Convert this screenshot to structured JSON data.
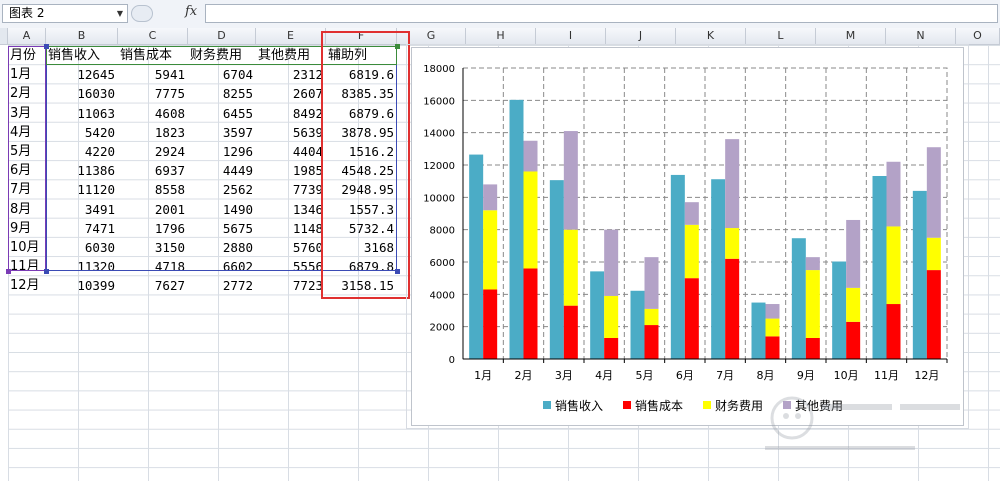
{
  "name_box": {
    "value": "图表 2",
    "dropdown_icon": "triangle-down-icon"
  },
  "formula_bar": {
    "fx_label": "fx",
    "value": ""
  },
  "column_headers": [
    "A",
    "B",
    "C",
    "D",
    "E",
    "F",
    "G",
    "H",
    "I",
    "J",
    "K",
    "L",
    "M",
    "N",
    "O"
  ],
  "table": {
    "headers": [
      "月份",
      "销售收入",
      "销售成本",
      "财务费用",
      "其他费用",
      "辅助列"
    ],
    "rows": [
      [
        "1月",
        "12645",
        "5941",
        "6704",
        "2312",
        "6819.6"
      ],
      [
        "2月",
        "16030",
        "7775",
        "8255",
        "2607",
        "8385.35"
      ],
      [
        "3月",
        "11063",
        "4608",
        "6455",
        "8492",
        "6879.6"
      ],
      [
        "4月",
        "5420",
        "1823",
        "3597",
        "5639",
        "3878.95"
      ],
      [
        "5月",
        "4220",
        "2924",
        "1296",
        "4404",
        "1516.2"
      ],
      [
        "6月",
        "11386",
        "6937",
        "4449",
        "1985",
        "4548.25"
      ],
      [
        "7月",
        "11120",
        "8558",
        "2562",
        "7739",
        "2948.95"
      ],
      [
        "8月",
        "3491",
        "2001",
        "1490",
        "1346",
        "1557.3"
      ],
      [
        "9月",
        "7471",
        "1796",
        "5675",
        "1148",
        "5732.4"
      ],
      [
        "10月",
        "6030",
        "3150",
        "2880",
        "5760",
        "3168"
      ],
      [
        "11月",
        "11320",
        "4718",
        "6602",
        "5556",
        "6879.8"
      ],
      [
        "12月",
        "10399",
        "7627",
        "2772",
        "7723",
        "3158.15"
      ]
    ]
  },
  "chart_data": {
    "type": "bar",
    "categories": [
      "1月",
      "2月",
      "3月",
      "4月",
      "5月",
      "6月",
      "7月",
      "8月",
      "9月",
      "10月",
      "11月",
      "12月"
    ],
    "ylim": [
      0,
      18000
    ],
    "yticks": [
      "0",
      "2000",
      "4000",
      "6000",
      "8000",
      "10000",
      "12000",
      "14000",
      "16000",
      "18000"
    ],
    "grid": true,
    "legend_position": "bottom",
    "series": [
      {
        "name": "销售收入",
        "color": "#4bacc6",
        "values": [
          12645,
          16030,
          11063,
          5420,
          4220,
          11386,
          11120,
          3491,
          7471,
          6030,
          11320,
          10399
        ]
      },
      {
        "name": "销售成本",
        "color": "#ff0000",
        "values": [
          4300,
          5600,
          3300,
          1300,
          2100,
          5000,
          6200,
          1400,
          1300,
          2300,
          3400,
          5500
        ]
      },
      {
        "name": "财务费用",
        "color": "#ffff00",
        "values": [
          4900,
          6000,
          4700,
          2600,
          1000,
          3300,
          1900,
          1100,
          4200,
          2100,
          4800,
          2000
        ]
      },
      {
        "name": "其他费用",
        "color": "#b3a2c7",
        "values": [
          1600,
          1900,
          6100,
          4100,
          3200,
          1400,
          5500,
          900,
          800,
          4200,
          4000,
          5600
        ]
      }
    ],
    "stack_groups": [
      [
        "销售收入"
      ],
      [
        "销售成本",
        "财务费用",
        "其他费用"
      ]
    ]
  }
}
